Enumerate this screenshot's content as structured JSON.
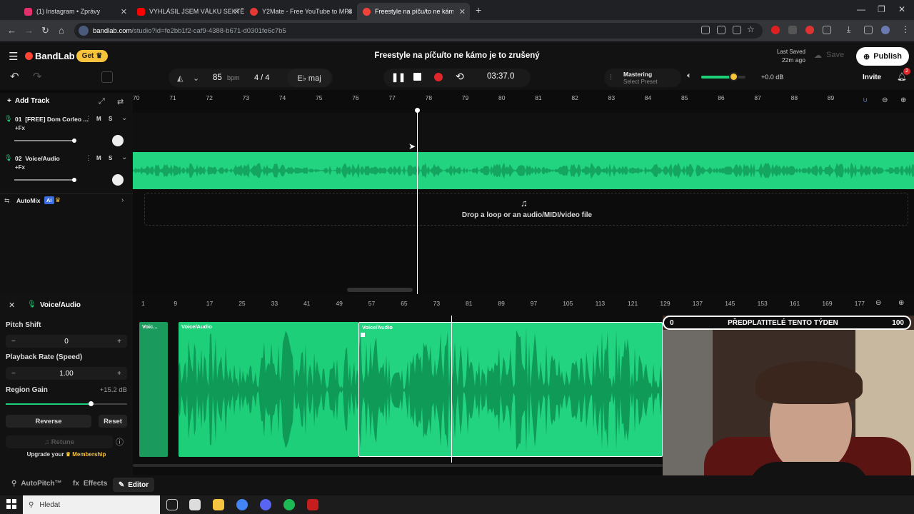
{
  "browser": {
    "tabs": [
      {
        "title": "(1) Instagram • Zprávy",
        "color": "#e1306c"
      },
      {
        "title": "VYHLÁSIL JSEM VÁLKU SEKTĚ, I",
        "color": "#ff0000"
      },
      {
        "title": "Y2Mate - Free YouTube to MP3",
        "color": "#e53935"
      },
      {
        "title": "Freestyle na píču/to ne kámo",
        "color": "#f2433b"
      }
    ],
    "url_host": "bandlab.com",
    "url_path": "/studio?id=fe2bb1f2-caf9-4388-b671-d0301fe6c7b5",
    "new_tab": "+"
  },
  "app": {
    "brand": "BandLab",
    "get_label": "Get",
    "project_title": "Freestyle na píču/to ne kámo je to zrušený",
    "last_saved_label": "Last Saved",
    "last_saved_time": "22m ago",
    "save_label": "Save",
    "publish_label": "Publish",
    "invite_label": "Invite",
    "notifications": "2"
  },
  "transport": {
    "bpm": "85",
    "bpm_unit": "bpm",
    "time_sig": "4 / 4",
    "key": "E♭ maj",
    "time": "03:37.0",
    "mastering_label": "Mastering",
    "mastering_preset": "Select Preset",
    "volume_db": "+0.0 dB",
    "volume_level": 0.72
  },
  "tracks_panel": {
    "add_track": "Add Track",
    "tracks": [
      {
        "num": "01",
        "name": "[FREE] Dom Corleo ...",
        "fx": "+Fx",
        "m": "M",
        "s": "S"
      },
      {
        "num": "02",
        "name": "Voice/Audio",
        "fx": "+Fx",
        "m": "M",
        "s": "S"
      }
    ],
    "automix": "AutoMix",
    "ai_badge": "AI"
  },
  "ruler": [
    "70",
    "71",
    "72",
    "73",
    "74",
    "75",
    "76",
    "77",
    "78",
    "79",
    "80",
    "81",
    "82",
    "83",
    "84",
    "85",
    "86",
    "87",
    "88",
    "89"
  ],
  "drop_zone": "Drop a loop or an audio/MIDI/video file",
  "editor": {
    "track_name": "Voice/Audio",
    "pitch_shift_label": "Pitch Shift",
    "pitch_shift_value": "0",
    "playback_rate_label": "Playback Rate (Speed)",
    "playback_rate_value": "1.00",
    "region_gain_label": "Region Gain",
    "region_gain_value": "+15.2 dB",
    "region_gain_level": 0.7,
    "reverse_label": "Reverse",
    "reset_label": "Reset",
    "retune_label": "Retune",
    "upgrade_prefix": "Upgrade your",
    "upgrade_link": "Membership",
    "ruler": [
      "1",
      "9",
      "17",
      "25",
      "33",
      "41",
      "49",
      "57",
      "65",
      "73",
      "81",
      "89",
      "97",
      "105",
      "113",
      "121",
      "129",
      "137",
      "145",
      "153",
      "161",
      "169",
      "177"
    ],
    "regions": [
      "Voic...",
      "Voice/Audio",
      "Voice/Audio"
    ]
  },
  "bottom_tabs": {
    "autopitch": "AutoPitch™",
    "effects": "Effects",
    "editor": "Editor"
  },
  "overlay": {
    "left": "0",
    "title": "PŘEDPLATITELÉ TENTO TÝDEN",
    "right": "100"
  },
  "taskbar": {
    "search_placeholder": "Hledat"
  },
  "colors": {
    "accent_green": "#1ecf7a",
    "wave_green": "#22d47f",
    "record_red": "#e0262a",
    "brand_orange": "#ff4433",
    "get_yellow": "#f7c33b"
  }
}
